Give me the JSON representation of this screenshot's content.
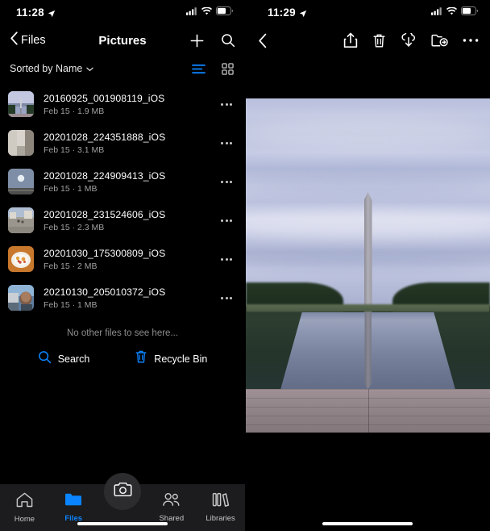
{
  "left": {
    "status": {
      "time": "11:28",
      "location_icon": "location-arrow-icon",
      "cellular_icon": "cellular-signal-icon",
      "wifi_icon": "wifi-icon",
      "battery_icon": "battery-icon"
    },
    "nav": {
      "back_label": "Files",
      "title": "Pictures",
      "add_label": "+",
      "search_icon": "search-icon"
    },
    "sort": {
      "label": "Sorted by Name",
      "chevron": "chevron-down-icon",
      "list_view_icon": "list-view-icon",
      "grid_view_icon": "grid-view-icon",
      "active_view": "list"
    },
    "files": [
      {
        "name": "20160925_001908119_iOS",
        "meta": "Feb 15 · 1.9 MB",
        "thumb": "reflecting-pool"
      },
      {
        "name": "20201028_224351888_iOS",
        "meta": "Feb 15 · 3.1 MB",
        "thumb": "alley"
      },
      {
        "name": "20201028_224909413_iOS",
        "meta": "Feb 15 · 1 MB",
        "thumb": "sun-beach"
      },
      {
        "name": "20201028_231524606_iOS",
        "meta": "Feb 15 · 2.3 MB",
        "thumb": "plaza"
      },
      {
        "name": "20201030_175300809_iOS",
        "meta": "Feb 15 · 2 MB",
        "thumb": "food-plate"
      },
      {
        "name": "20210130_205010372_iOS",
        "meta": "Feb 15 · 1 MB",
        "thumb": "portrait"
      }
    ],
    "row_more_icon": "more-options-icon",
    "footer": {
      "empty_text": "No other files to see here...",
      "actions": [
        {
          "label": "Search",
          "icon": "search-icon"
        },
        {
          "label": "Recycle Bin",
          "icon": "trash-icon"
        }
      ]
    },
    "tabs": [
      {
        "label": "Home",
        "icon": "home-icon",
        "active": false
      },
      {
        "label": "Files",
        "icon": "folder-icon",
        "active": true
      },
      {
        "label": "Shared",
        "icon": "people-icon",
        "active": false
      },
      {
        "label": "Libraries",
        "icon": "libraries-icon",
        "active": false
      }
    ],
    "camera_button": {
      "icon": "camera-icon"
    }
  },
  "right": {
    "status": {
      "time": "11:29",
      "location_icon": "location-arrow-icon",
      "cellular_icon": "cellular-signal-icon",
      "wifi_icon": "wifi-icon",
      "battery_icon": "battery-icon"
    },
    "toolbar": {
      "back_icon": "chevron-left-icon",
      "actions": [
        {
          "icon": "share-icon",
          "name": "share"
        },
        {
          "icon": "trash-icon",
          "name": "delete"
        },
        {
          "icon": "download-icon",
          "name": "download"
        },
        {
          "icon": "move-folder-icon",
          "name": "move-to-folder"
        },
        {
          "icon": "more-options-icon",
          "name": "more"
        }
      ]
    },
    "photo": {
      "subject": "Washington Monument and Lincoln Memorial Reflecting Pool"
    }
  },
  "colors": {
    "accent_blue": "#0a84ff",
    "background": "#000000",
    "tabbar_background": "#1c1c1e",
    "secondary_text": "#a0a0a0"
  }
}
